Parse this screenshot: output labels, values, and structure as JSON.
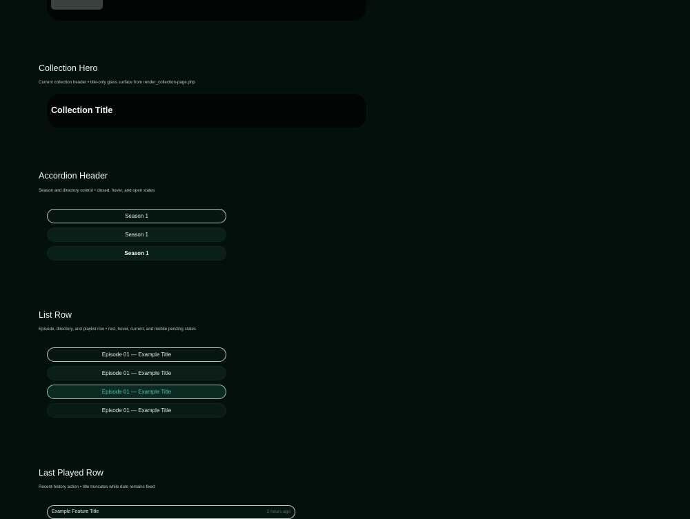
{
  "sections": {
    "collection_hero": {
      "title": "Collection Hero",
      "description": "Current collection header • title-only glass surface from render_collection-page.php",
      "card_title": "Collection Title"
    },
    "accordion_header": {
      "title": "Accordion Header",
      "description": "Season and directory control • closed, hover, and open states",
      "states": [
        {
          "state": "closed",
          "label": "Season 1"
        },
        {
          "state": "hover",
          "label": "Season 1"
        },
        {
          "state": "open",
          "label": "Season 1"
        }
      ]
    },
    "list_row": {
      "title": "List Row",
      "description": "Episode, directory, and playlist row • rest, hover, current, and mobile pending states",
      "states": [
        {
          "state": "rest",
          "label": "Episode 01 — Example Title"
        },
        {
          "state": "hover",
          "label": "Episode 01 — Example Title"
        },
        {
          "state": "current",
          "label": "Episode 01 — Example Title"
        },
        {
          "state": "mobile-pending",
          "label": "Episode 01 — Example Title"
        }
      ]
    },
    "last_played_row": {
      "title": "Last Played Row",
      "description": "Recent-history action • title truncates while date remains fixed",
      "row_title": "Example Feature Title",
      "row_date": "2 hours ago"
    }
  },
  "colors": {
    "background": "#04100d",
    "accent": "#4fc8a4",
    "border": "#b8c7c1"
  }
}
